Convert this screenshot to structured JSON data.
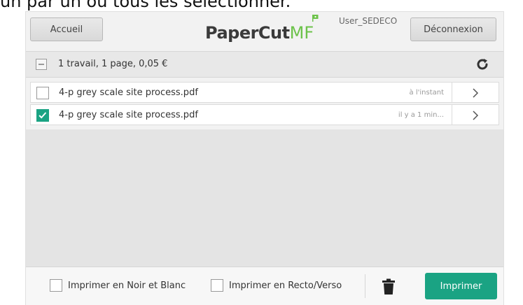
{
  "caption": "un par un ou tous les sélectionner.",
  "header": {
    "home_label": "Accueil",
    "logo_main": "PaperCut",
    "logo_accent": "MF",
    "username": "User_SEDECO",
    "logout_label": "Déconnexion"
  },
  "summary": {
    "text": "1 travail, 1 page, 0,05 €",
    "refresh_icon": "refresh-icon"
  },
  "jobs": [
    {
      "name": "4-p grey scale site process.pdf",
      "time": "à l'instant",
      "checked": false
    },
    {
      "name": "4-p grey scale site process.pdf",
      "time": "il y a 1 min...",
      "checked": true
    }
  ],
  "footer": {
    "bw_label": "Imprimer en Noir et Blanc",
    "duplex_label": "Imprimer en Recto/Verso",
    "delete_icon": "trash-icon",
    "print_label": "Imprimer"
  },
  "colors": {
    "accent": "#1aa383",
    "logo_green": "#6cc24a"
  }
}
